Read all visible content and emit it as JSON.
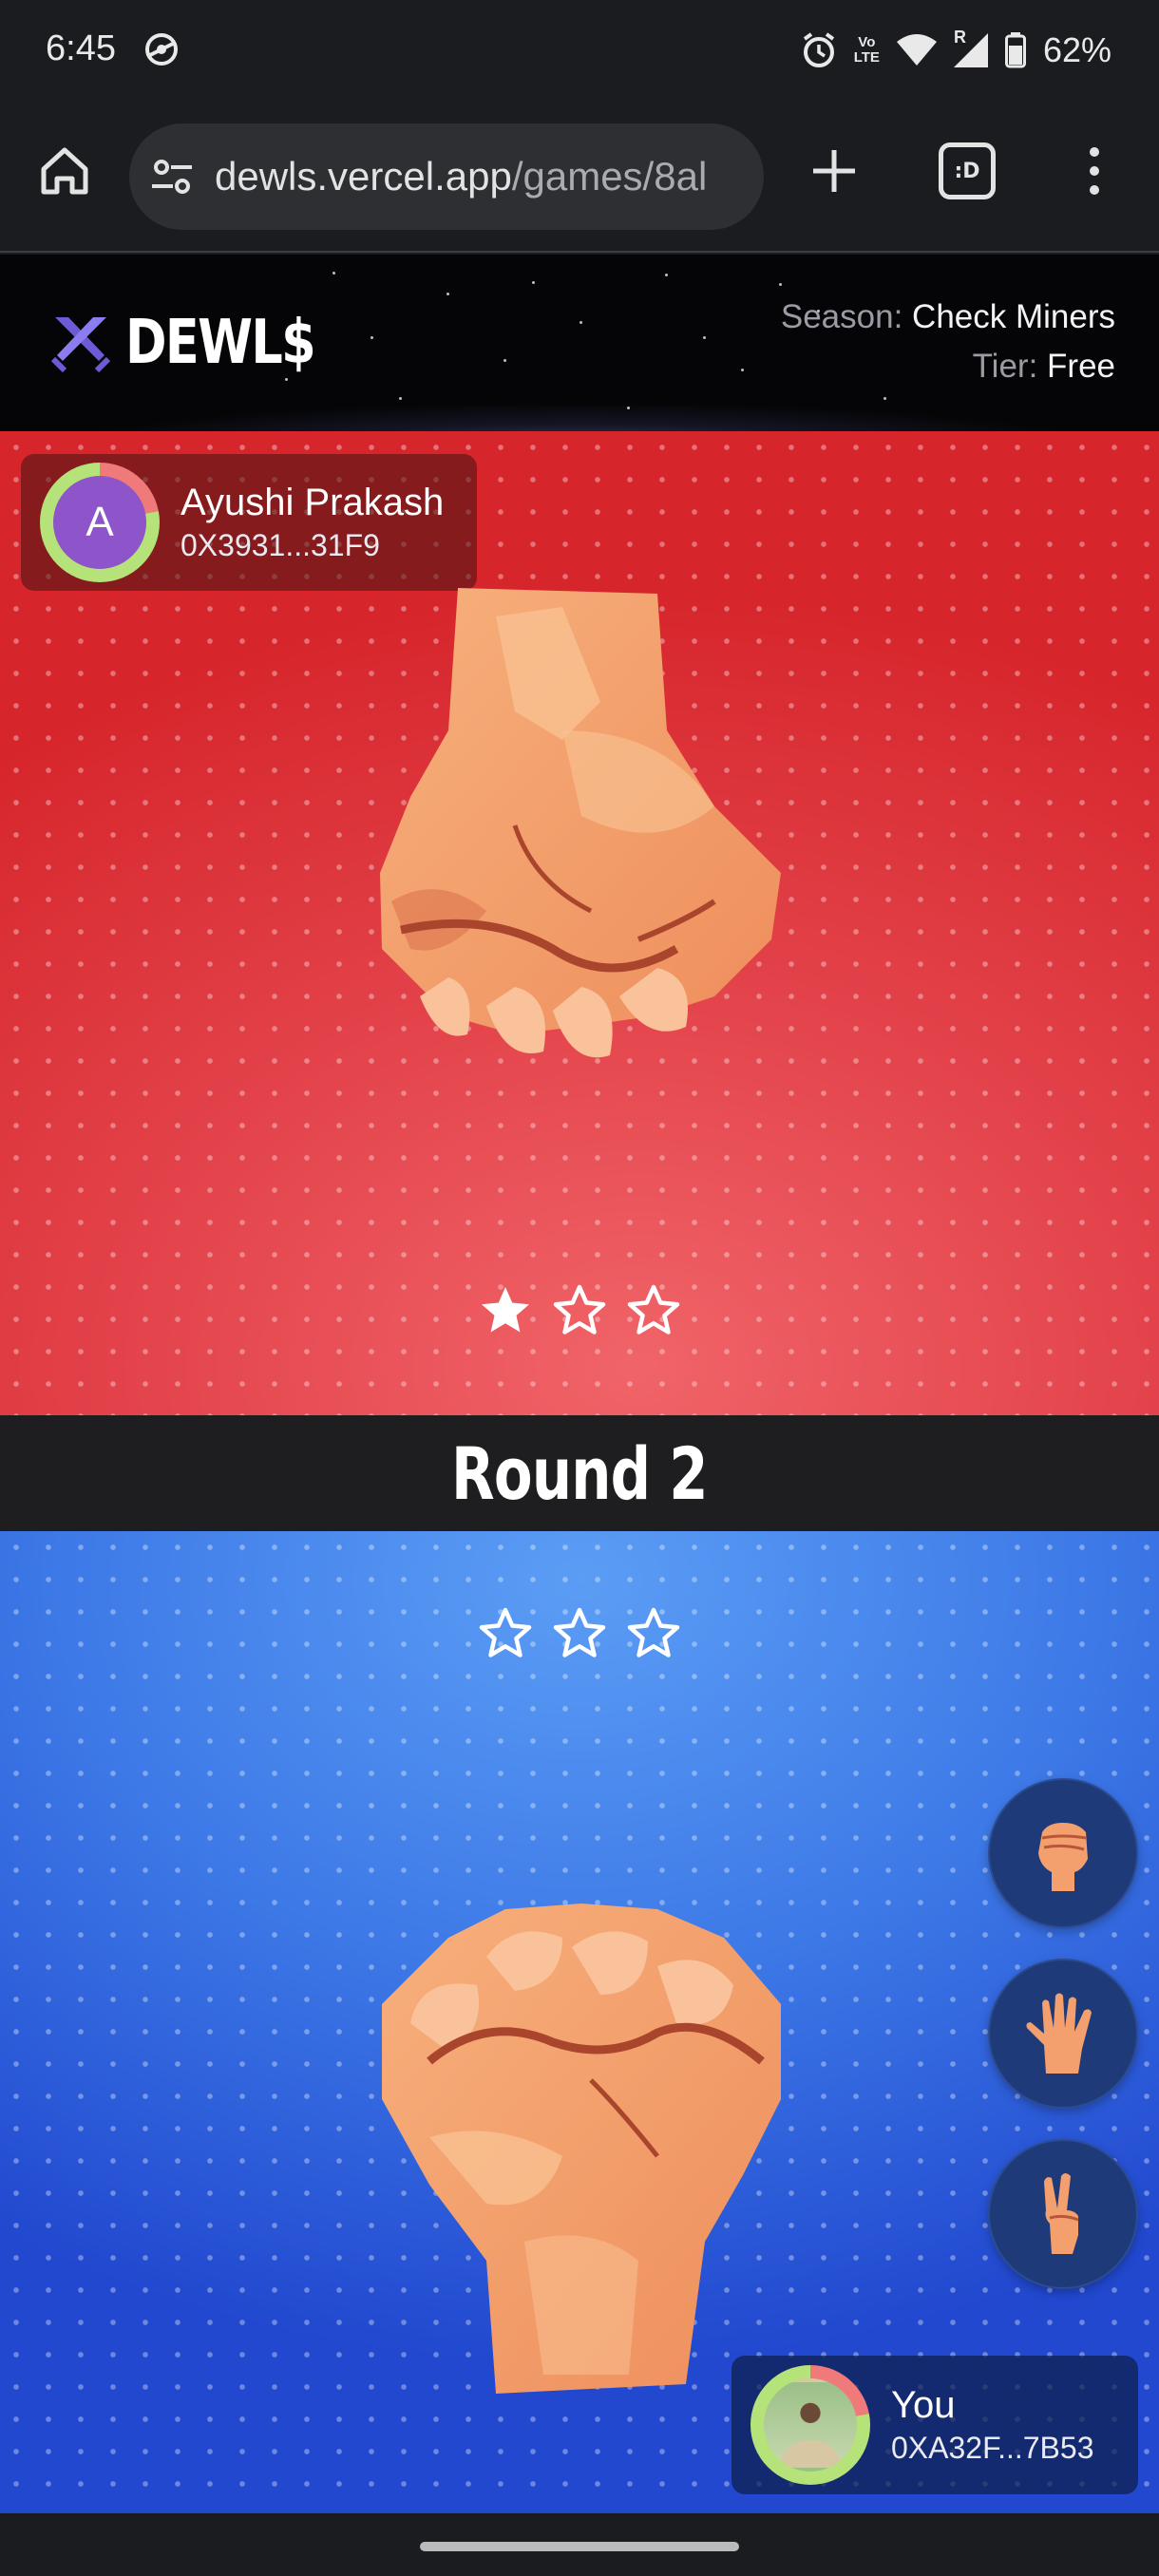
{
  "status_bar": {
    "time": "6:45",
    "network": "LTE",
    "signal_label": "R",
    "battery": "62%",
    "icons": [
      "vpn-icon",
      "alarm-icon",
      "volte-icon",
      "wifi-icon",
      "signal-icon",
      "battery-icon"
    ]
  },
  "browser": {
    "url_host": "dewls.vercel.app",
    "url_path": "/games/8al",
    "tab_switcher_label": ":D",
    "icons": [
      "home-icon",
      "site-settings-icon",
      "new-tab-icon",
      "tab-switcher-icon",
      "more-menu-icon"
    ]
  },
  "site": {
    "logo_text": "DEWL$",
    "season_label": "Season:",
    "season_value": "Check Miners",
    "tier_label": "Tier:",
    "tier_value": "Free"
  },
  "opponent": {
    "avatar_initial": "A",
    "name": "Ayushi Prakash",
    "address": "0X3931...31F9",
    "hand": "rock",
    "stars_won": 1,
    "stars_total": 3
  },
  "round": {
    "title": "Round 2"
  },
  "player": {
    "name": "You",
    "address": "0XA32F...7B53",
    "hand": "rock",
    "stars_won": 0,
    "stars_total": 3
  },
  "moves": [
    "rock",
    "paper",
    "scissors"
  ],
  "colors": {
    "opponent_bg": "#e3424a",
    "player_bg": "#3d79e7",
    "accent": "#6c5bd7"
  }
}
